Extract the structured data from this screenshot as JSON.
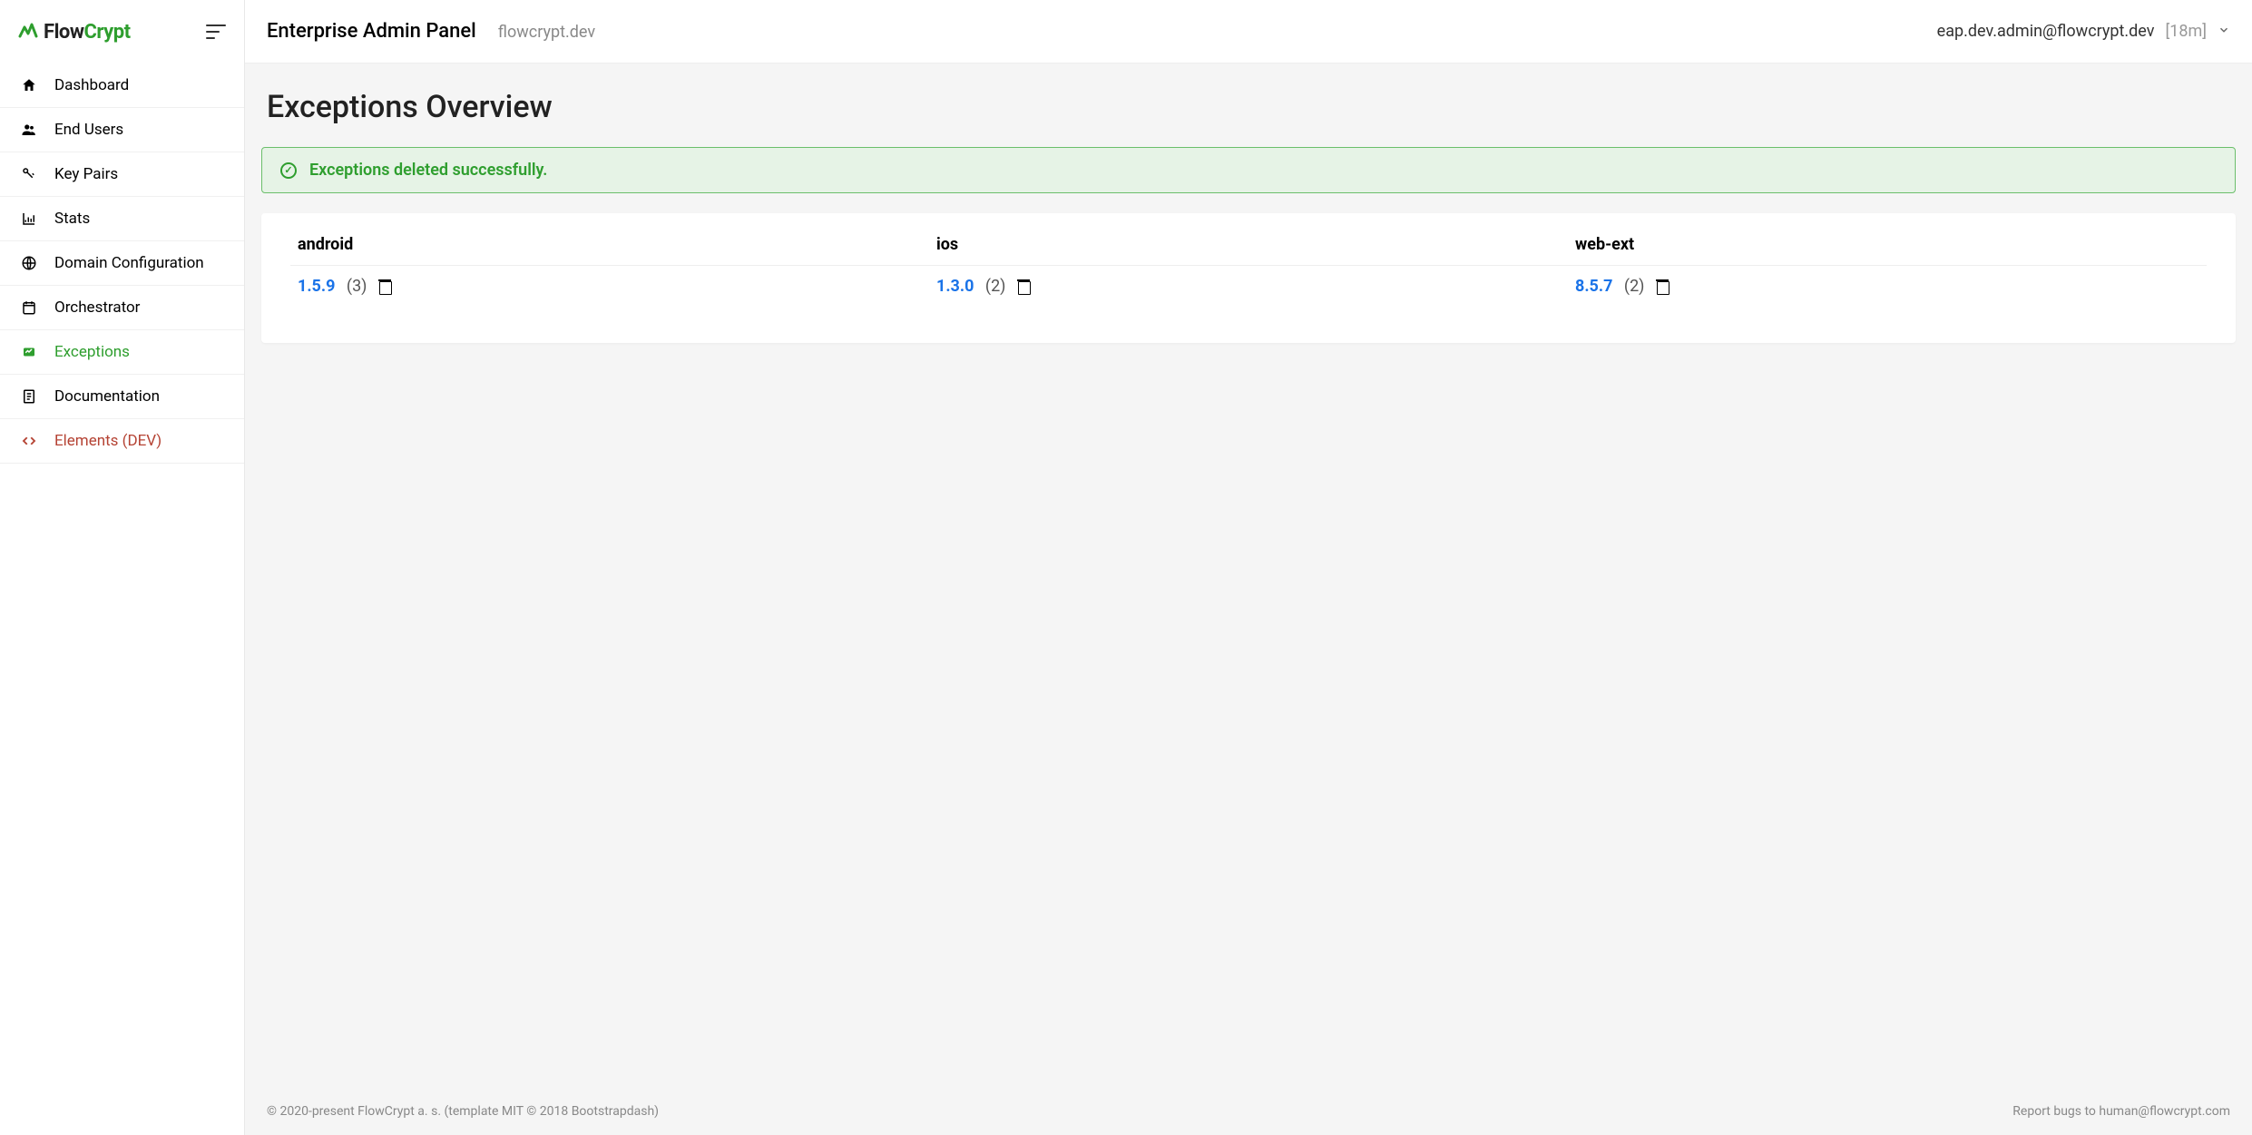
{
  "logo": {
    "brand1": "Flow",
    "brand2": "Crypt"
  },
  "sidebar": {
    "items": [
      {
        "label": "Dashboard",
        "icon": "home-icon"
      },
      {
        "label": "End Users",
        "icon": "users-icon"
      },
      {
        "label": "Key Pairs",
        "icon": "keys-icon"
      },
      {
        "label": "Stats",
        "icon": "stats-icon"
      },
      {
        "label": "Domain Configuration",
        "icon": "globe-icon"
      },
      {
        "label": "Orchestrator",
        "icon": "calendar-icon"
      },
      {
        "label": "Exceptions",
        "icon": "exceptions-icon",
        "active": true
      },
      {
        "label": "Documentation",
        "icon": "doc-icon"
      },
      {
        "label": "Elements (DEV)",
        "icon": "code-icon",
        "dev": true
      }
    ]
  },
  "header": {
    "title": "Enterprise Admin Panel",
    "domain": "flowcrypt.dev",
    "user_email": "eap.dev.admin@flowcrypt.dev",
    "session_time": "[18m]"
  },
  "page": {
    "title": "Exceptions Overview"
  },
  "alert": {
    "message": "Exceptions deleted successfully."
  },
  "exceptions": {
    "columns": [
      {
        "platform": "android",
        "version": "1.5.9",
        "count": "(3)"
      },
      {
        "platform": "ios",
        "version": "1.3.0",
        "count": "(2)"
      },
      {
        "platform": "web-ext",
        "version": "8.5.7",
        "count": "(2)"
      }
    ]
  },
  "footer": {
    "copyright": "© 2020-present FlowCrypt a. s. (template MIT © 2018 Bootstrapdash)",
    "bugs_label": "Report bugs to ",
    "bugs_email": "human@flowcrypt.com"
  }
}
